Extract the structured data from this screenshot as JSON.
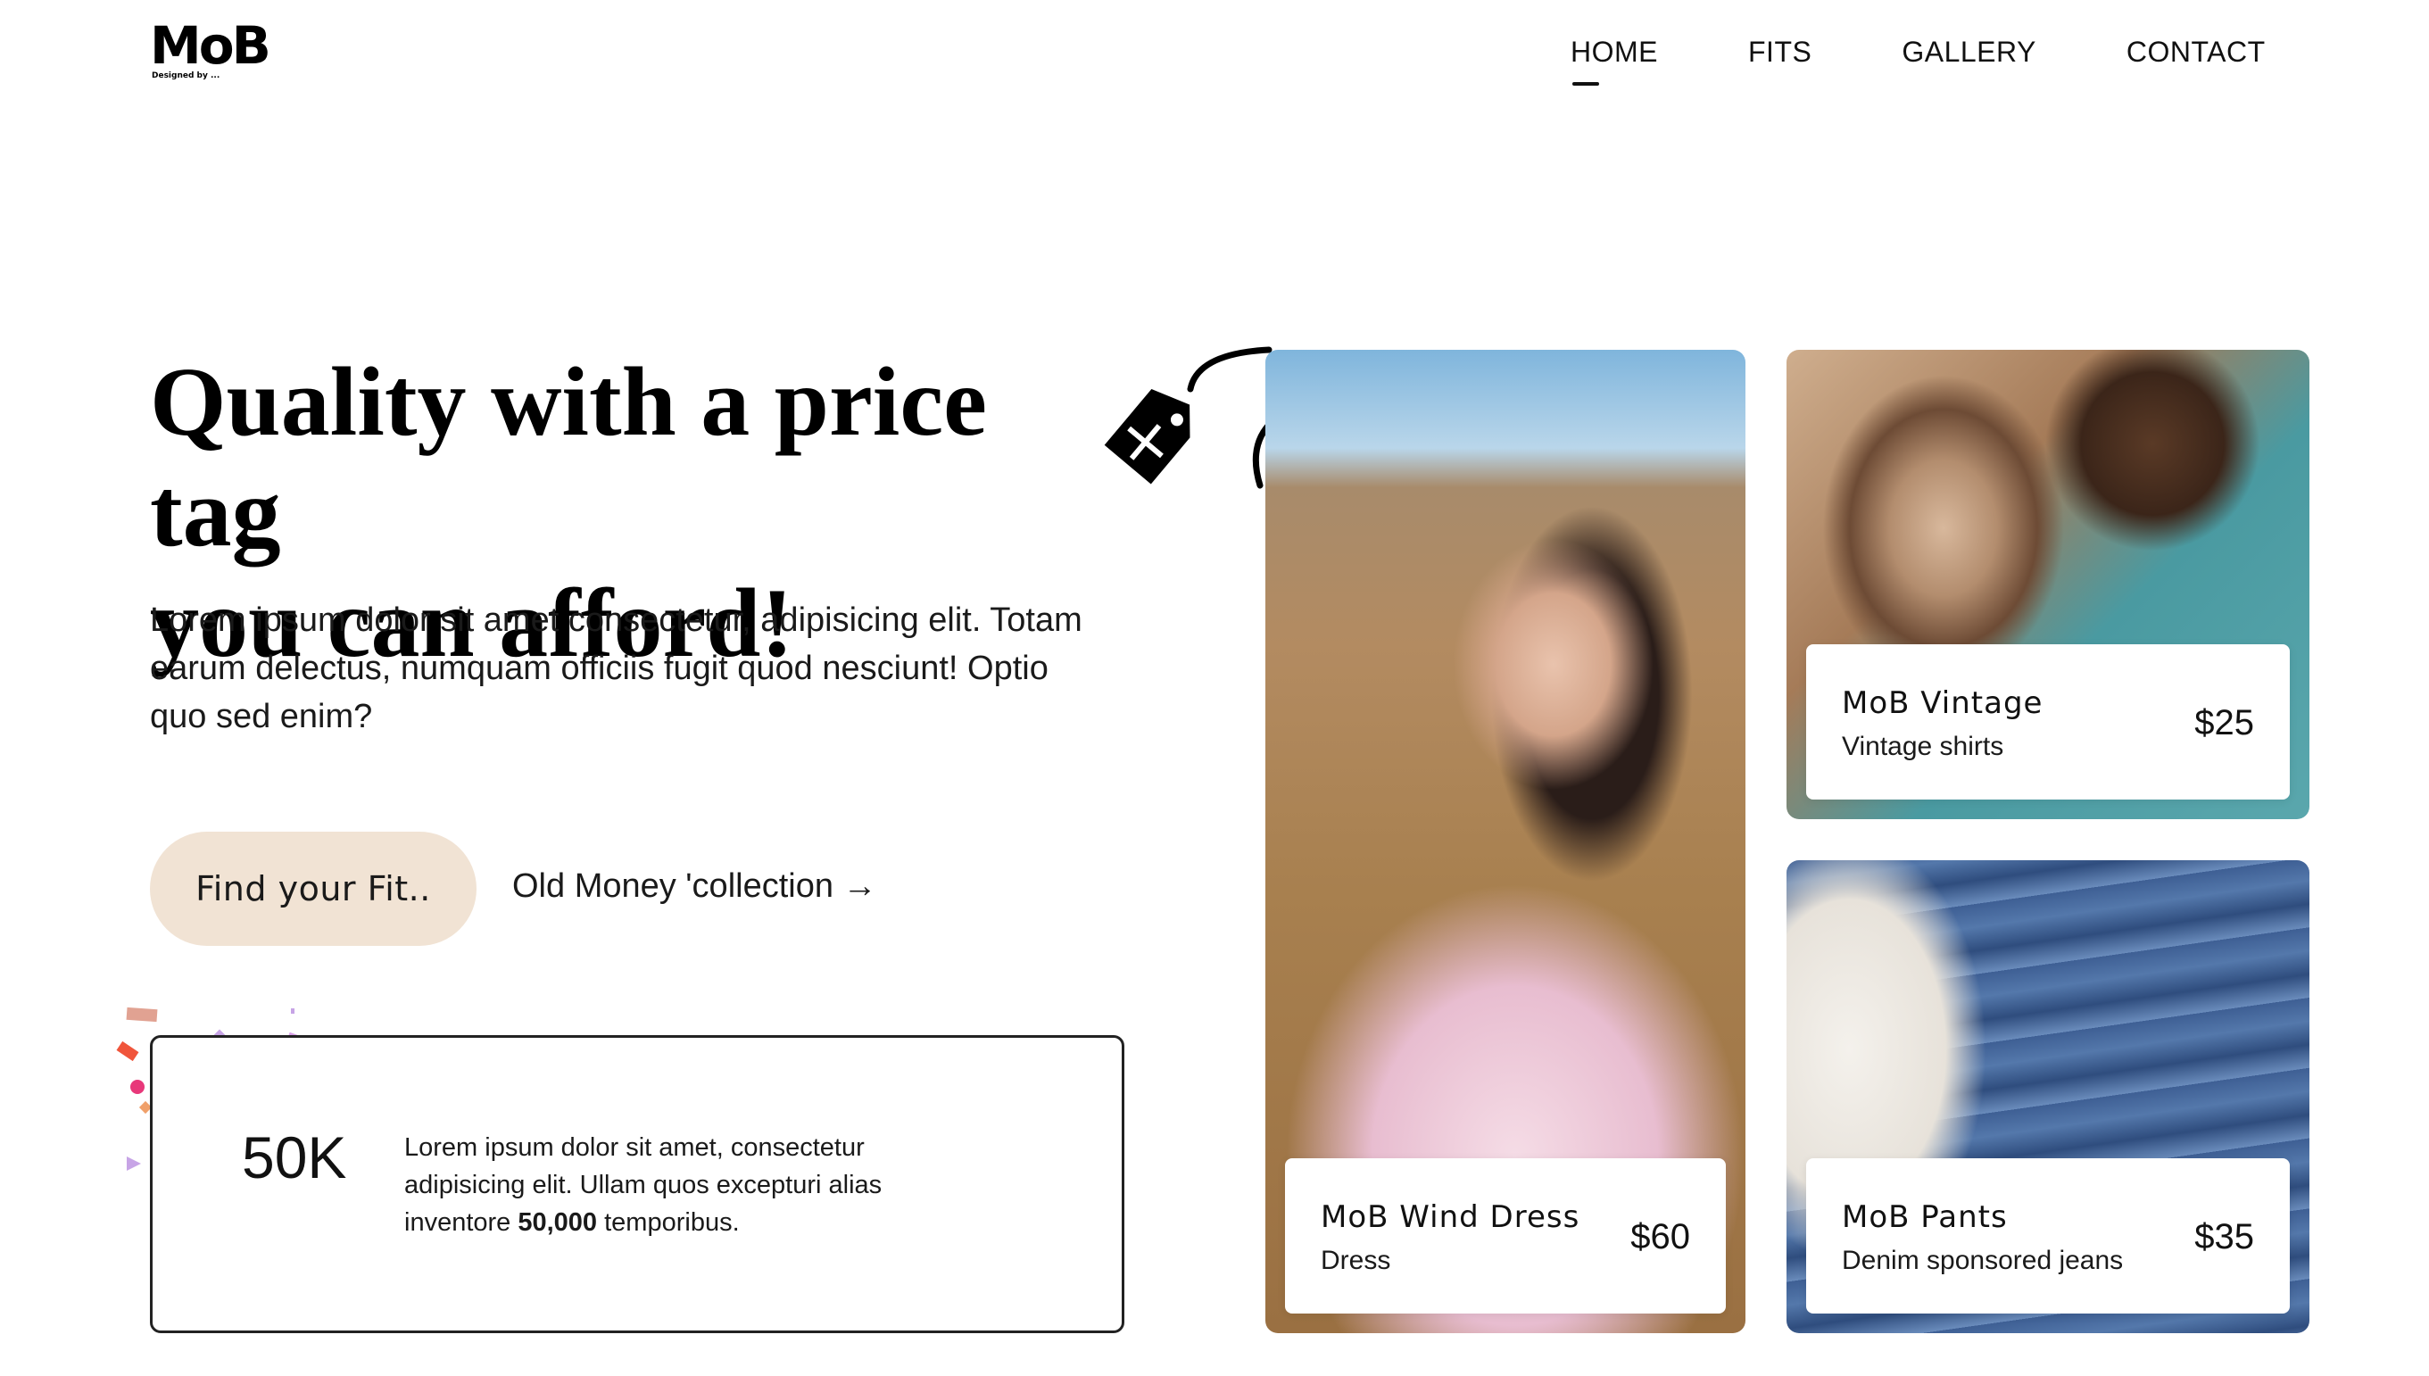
{
  "header": {
    "logo": "MoB",
    "logo_tagline": "Designed by ...",
    "nav": [
      {
        "label": "HOME",
        "active": true
      },
      {
        "label": "FITS",
        "active": false
      },
      {
        "label": "GALLERY",
        "active": false
      },
      {
        "label": "CONTACT",
        "active": false
      }
    ]
  },
  "hero": {
    "title_line1": "Quality with a price tag",
    "title_line2": "you can afford!",
    "description": "Lorem ipsum dolor sit amet consectetur, adipisicing elit. Totam earum delectus, numquam officiis fugit quod nesciunt! Optio quo sed enim?",
    "primary_button": "Find your Fit..",
    "secondary_link": "Old Money 'collection →"
  },
  "stats": {
    "number": "50K",
    "text_before": "Lorem ipsum dolor sit amet, consectetur adipisicing elit. Ullam quos excepturi alias inventore ",
    "text_bold": "50,000",
    "text_after": " temporibus."
  },
  "products": [
    {
      "name": "MoB Wind Dress",
      "category": "Dress",
      "price": "$60",
      "icon": "woman-in-pink-dress-photo"
    },
    {
      "name": "MoB Vintage",
      "category": "Vintage shirts",
      "price": "$25",
      "icon": "snakeskin-shirt-photo"
    },
    {
      "name": "MoB Pants",
      "category": "Denim sponsored jeans",
      "price": "$35",
      "icon": "folded-jeans-photo"
    }
  ],
  "decor": {
    "tag_icon": "price-tag-plus-icon",
    "confetti_colors": [
      "#e1a292",
      "#f0553b",
      "#e8387a",
      "#7d3cc0",
      "#c7a4e6",
      "#d8a0e8"
    ]
  }
}
